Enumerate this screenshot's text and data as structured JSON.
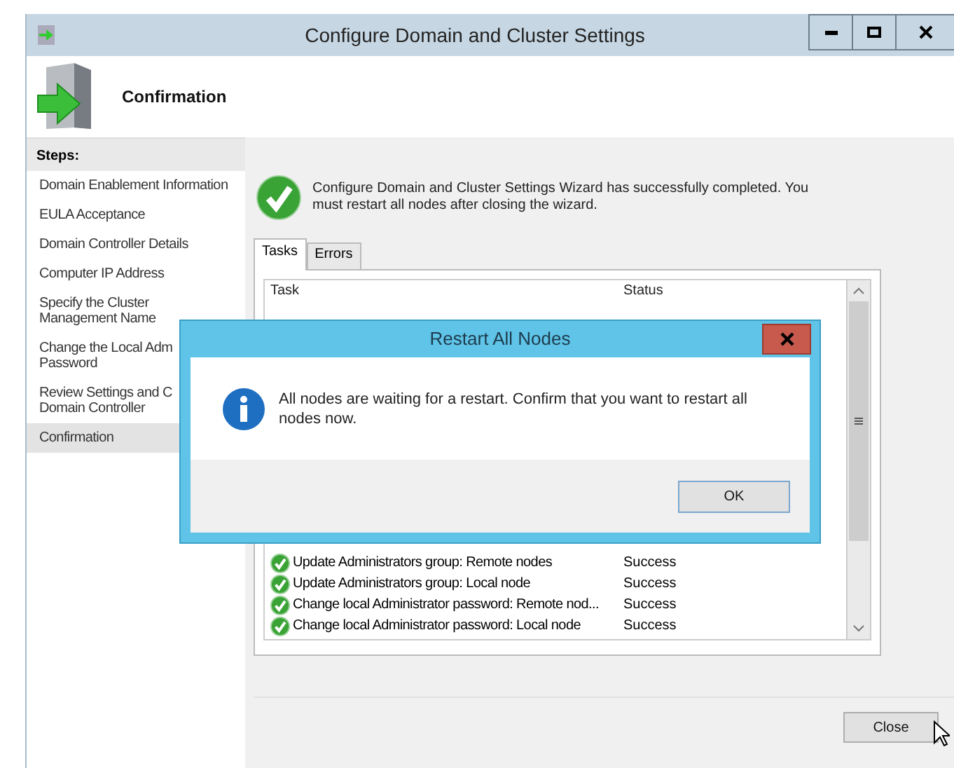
{
  "window": {
    "title": "Configure Domain and Cluster Settings"
  },
  "header": {
    "title": "Confirmation"
  },
  "steps": {
    "heading": "Steps:",
    "items": [
      {
        "label": "Domain Enablement Information",
        "selected": false
      },
      {
        "label": "EULA Acceptance",
        "selected": false
      },
      {
        "label": "Domain Controller Details",
        "selected": false
      },
      {
        "label": "Computer IP Address",
        "selected": false
      },
      {
        "label": "Specify the Cluster\nManagement Name",
        "selected": false
      },
      {
        "label": "Change the Local Adm\nPassword",
        "selected": false
      },
      {
        "label": "Review Settings and C\nDomain Controller",
        "selected": false
      },
      {
        "label": "Confirmation",
        "selected": true
      }
    ]
  },
  "message": "Configure Domain and Cluster Settings Wizard has successfully completed. You must restart all nodes after closing the wizard.",
  "tabs": [
    {
      "label": "Tasks",
      "selected": true
    },
    {
      "label": "Errors",
      "selected": false
    }
  ],
  "table": {
    "columns": [
      "Task",
      "Status"
    ],
    "rows": [
      {
        "task": "Update Administrators group: Remote nodes",
        "status": "Success"
      },
      {
        "task": "Update Administrators group: Local node",
        "status": "Success"
      },
      {
        "task": "Change local Administrator password: Remote nod...",
        "status": "Success"
      },
      {
        "task": "Change local Administrator password: Local node",
        "status": "Success"
      }
    ]
  },
  "buttons": [
    "Close"
  ],
  "dialog": {
    "title": "Restart All Nodes",
    "text": "All nodes are waiting for a restart. Confirm that you want to restart all nodes now.",
    "button": "OK"
  }
}
